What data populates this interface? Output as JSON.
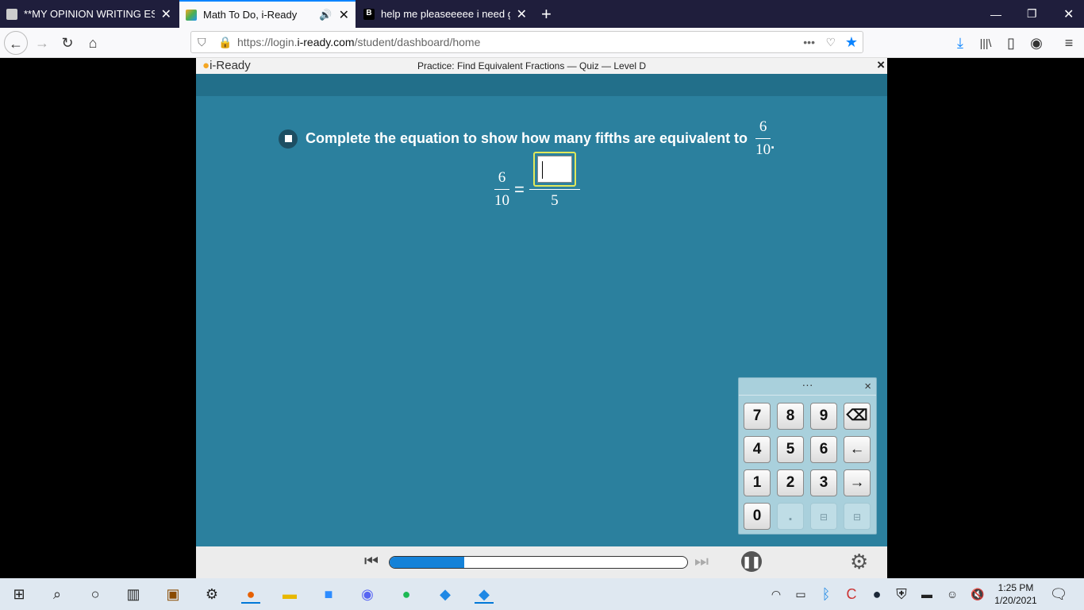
{
  "browser": {
    "tabs": [
      {
        "title": "**MY OPINION WRITING ESSAY",
        "active": false
      },
      {
        "title": "Math To Do, i-Ready",
        "active": true,
        "audio_icon": "speaker-icon"
      },
      {
        "title": "help me pleaseeeee i need goo",
        "active": false
      }
    ],
    "url_prefix": "https://login.",
    "url_domain": "i-ready.com",
    "url_path": "/student/dashboard/home"
  },
  "app": {
    "logo": "i-Ready",
    "title": "Practice: Find Equivalent Fractions — Quiz — Level D",
    "close": "×",
    "question": "Complete the equation to show how many fifths are equivalent to",
    "q_frac": {
      "num": "6",
      "den": "10"
    },
    "q_period": ".",
    "eq_left": {
      "num": "6",
      "den": "10"
    },
    "eq_sign": "=",
    "eq_right_den": "5",
    "answer_value": "",
    "keypad": {
      "handle": "···",
      "close": "×",
      "keys": [
        "7",
        "8",
        "9",
        "⌫",
        "4",
        "5",
        "6",
        "←",
        "1",
        "2",
        "3",
        "→",
        "0",
        "."
      ]
    },
    "progress_percent": 25
  },
  "taskbar": {
    "time": "1:25 PM",
    "date": "1/20/2021"
  },
  "colors": {
    "teal": "#2b809e",
    "progress": "#1582d8",
    "tab_accent": "#0a84ff"
  }
}
